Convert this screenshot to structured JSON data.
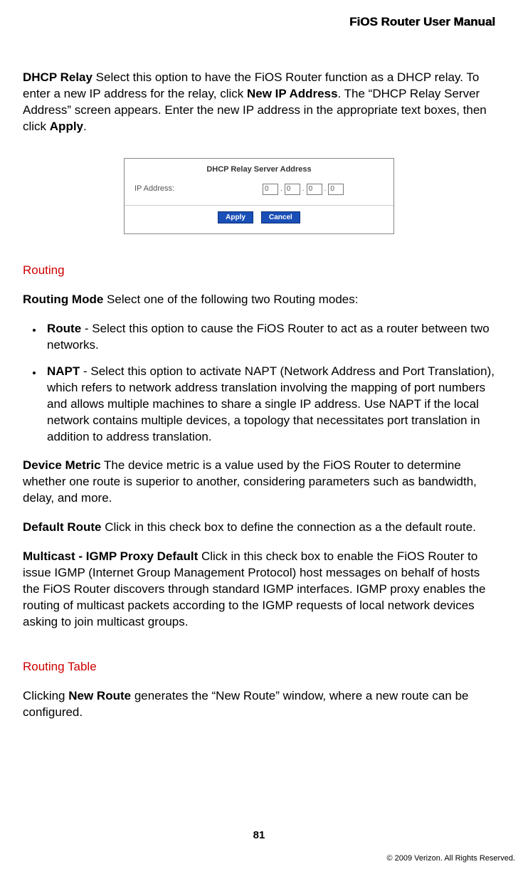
{
  "header": "FiOS Router User Manual",
  "para1": {
    "lead_bold": "DHCP Relay",
    "text1": "  Select this option to have the FiOS Router function as a DHCP relay. To enter a new IP address for the relay, click ",
    "bold2": "New IP Address",
    "text2": ". The “DHCP Relay Server Address” screen appears. Enter the new IP address in the appropriate text boxes, then click ",
    "bold3": "Apply",
    "text3": "."
  },
  "figure": {
    "title": "DHCP Relay Server Address",
    "label": "IP Address:",
    "ip": [
      "0",
      "0",
      "0",
      "0"
    ],
    "apply": "Apply",
    "cancel": "Cancel"
  },
  "routing_heading": "Routing",
  "routing_mode": {
    "bold": "Routing Mode",
    "text": "  Select one of the following two Routing modes:"
  },
  "route_item": {
    "bold": "Route",
    "text": " - Select this option to cause the FiOS Router to act as a router between two networks."
  },
  "napt_item": {
    "bold": "NAPT",
    "text": " - Select this option to activate NAPT (Network Address and Port Translation), which refers to network address translation involving the mapping of port numbers and allows multiple machines to share a single IP address. Use NAPT if the local network contains multiple devices, a topology that necessitates port translation in addition to address translation."
  },
  "device_metric": {
    "bold": "Device Metric",
    "text": "  The device metric is a value used by the FiOS Router to determine whether one route is superior to another, considering parameters such as bandwidth, delay, and more."
  },
  "default_route": {
    "bold": "Default Route",
    "text": "  Click in this check box to define the connection as a the default route."
  },
  "multicast": {
    "bold": "Multicast - IGMP Proxy Default",
    "text": "  Click in this check box to enable the FiOS Router to issue IGMP (Internet Group Management Protocol) host messages on behalf of hosts the FiOS Router discovers through standard IGMP interfaces. IGMP proxy enables the routing of multicast packets according to the IGMP requests of local network devices asking to join multicast groups."
  },
  "routing_table_heading": "Routing Table",
  "routing_table_para": {
    "text1": "Clicking ",
    "bold": "New Route",
    "text2": " generates the “New Route” window, where a new route can be configured."
  },
  "page_number": "81",
  "copyright": "© 2009 Verizon. All Rights Reserved."
}
